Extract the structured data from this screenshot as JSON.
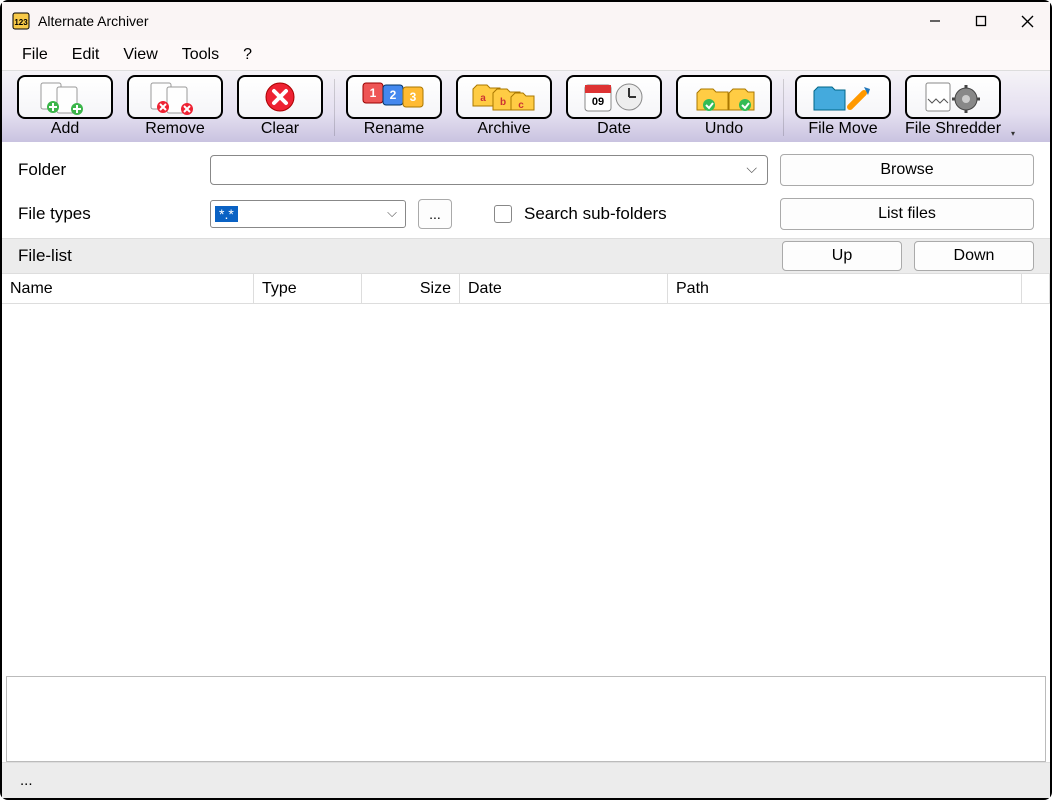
{
  "window": {
    "title": "Alternate Archiver"
  },
  "menu": {
    "file": "File",
    "edit": "Edit",
    "view": "View",
    "tools": "Tools",
    "help": "?"
  },
  "toolbar": {
    "add": "Add",
    "remove": "Remove",
    "clear": "Clear",
    "rename": "Rename",
    "archive": "Archive",
    "date": "Date",
    "undo": "Undo",
    "filemove": "File Move",
    "fileshredder": "File Shredder"
  },
  "labels": {
    "folder": "Folder",
    "filetypes": "File types",
    "browse": "Browse",
    "listfiles": "List files",
    "dots": "...",
    "searchsub": "Search sub-folders",
    "filelist": "File-list",
    "up": "Up",
    "down": "Down"
  },
  "values": {
    "folder": "",
    "filetype": "*.*"
  },
  "columns": {
    "name": "Name",
    "type": "Type",
    "size": "Size",
    "date": "Date",
    "path": "Path"
  },
  "status": "..."
}
